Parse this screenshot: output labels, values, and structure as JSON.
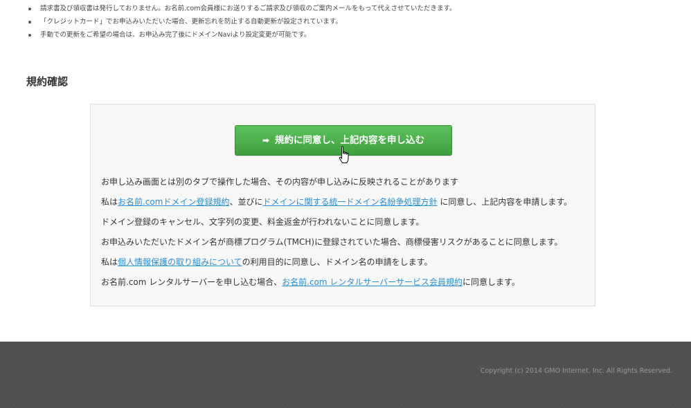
{
  "notes": [
    "請求書及び領収書は発行しておりません。お名前.com会員様にお送りするご請求及び領収のご案内メールをもって代えさせていただきます。",
    "「クレジットカード」でお申込みいただいた場合、更新忘れを防止する自動更新が設定されています。",
    "手動での更新をご希望の場合は、お申込み完了後にドメインNaviより設定変更が可能です。"
  ],
  "section_title": "規約確認",
  "agree_button": {
    "icon": "arrow-right-icon",
    "label": "規約に同意し、上記内容を申し込む"
  },
  "terms": {
    "line1": "お申し込み画面とは別のタブで操作した場合、その内容が申し込みに反映されることがあります",
    "line2": {
      "prefix": "私は",
      "link1": "お名前.comドメイン登録規約",
      "middle": "、並びに",
      "link2": "ドメインに関する統一ドメイン名紛争処理方針",
      "suffix": " に同意し、上記内容を申請します。"
    },
    "line3": "ドメイン登録のキャンセル、文字列の変更、料金返金が行われないことに同意します。",
    "line4": "お申込みいただいたドメイン名が商標プログラム(TMCH)に登録されていた場合、商標侵害リスクがあることに同意します。",
    "line5": {
      "prefix": "私は",
      "link": "個人情報保護の取り組みについて",
      "suffix": "の利用目的に同意し、ドメイン名の申請をします。"
    },
    "line6": {
      "prefix": "お名前.com レンタルサーバーを申し込む場合、",
      "link": "お名前.com レンタルサーバーサービス会員規約",
      "suffix": "に同意します。"
    }
  },
  "footer": {
    "copyright": "Copyright (c) 2014 GMO Internet, Inc. All Rights Reserved."
  },
  "colors": {
    "button": "#46a846",
    "link": "#2a8fcf",
    "footer": "#4f4f4f"
  }
}
